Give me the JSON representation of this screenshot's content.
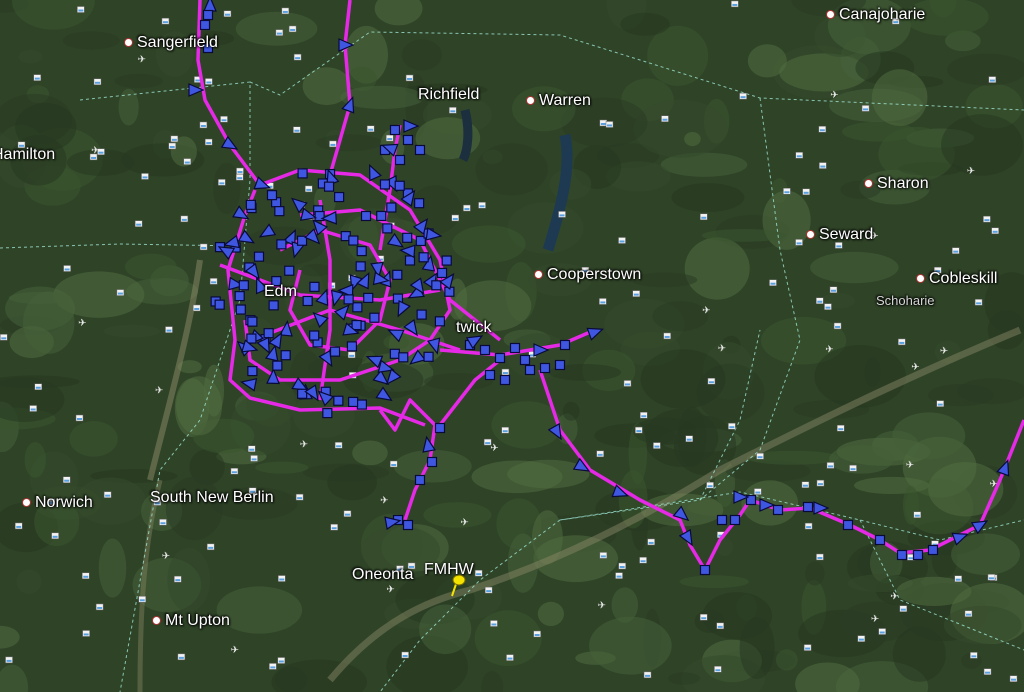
{
  "places": [
    {
      "id": "canajoharie",
      "name": "Canajoharie"
    },
    {
      "id": "sangerfield",
      "name": "Sangerfield"
    },
    {
      "id": "richfield",
      "name": "Richfield"
    },
    {
      "id": "warren",
      "name": "Warren"
    },
    {
      "id": "hamilton",
      "name": "Hamilton"
    },
    {
      "id": "sharon",
      "name": "Sharon"
    },
    {
      "id": "seward",
      "name": "Seward"
    },
    {
      "id": "cooperstown",
      "name": "Cooperstown"
    },
    {
      "id": "cobleskill",
      "name": "Cobleskill"
    },
    {
      "id": "schoharie",
      "name": "Schoharie"
    },
    {
      "id": "edmeston",
      "name": "Edm"
    },
    {
      "id": "hartwick",
      "name": "twick"
    },
    {
      "id": "norwich",
      "name": "Norwich"
    },
    {
      "id": "south-new-berlin",
      "name": "South New Berlin"
    },
    {
      "id": "oneonta",
      "name": "Oneonta"
    },
    {
      "id": "mt-upton",
      "name": "Mt Upton"
    }
  ],
  "airport_pin": {
    "label": "FMHW"
  },
  "colors": {
    "track": "#e629e6",
    "marker_fill": "#3f57e0",
    "marker_stroke": "#0a0a3a",
    "boundary": "#9fe6d6",
    "pin": "#f4e200"
  },
  "icons": [
    "weather-station-icon",
    "airport-icon",
    "triangle-marker-icon",
    "square-marker-icon",
    "pushpin-icon"
  ]
}
